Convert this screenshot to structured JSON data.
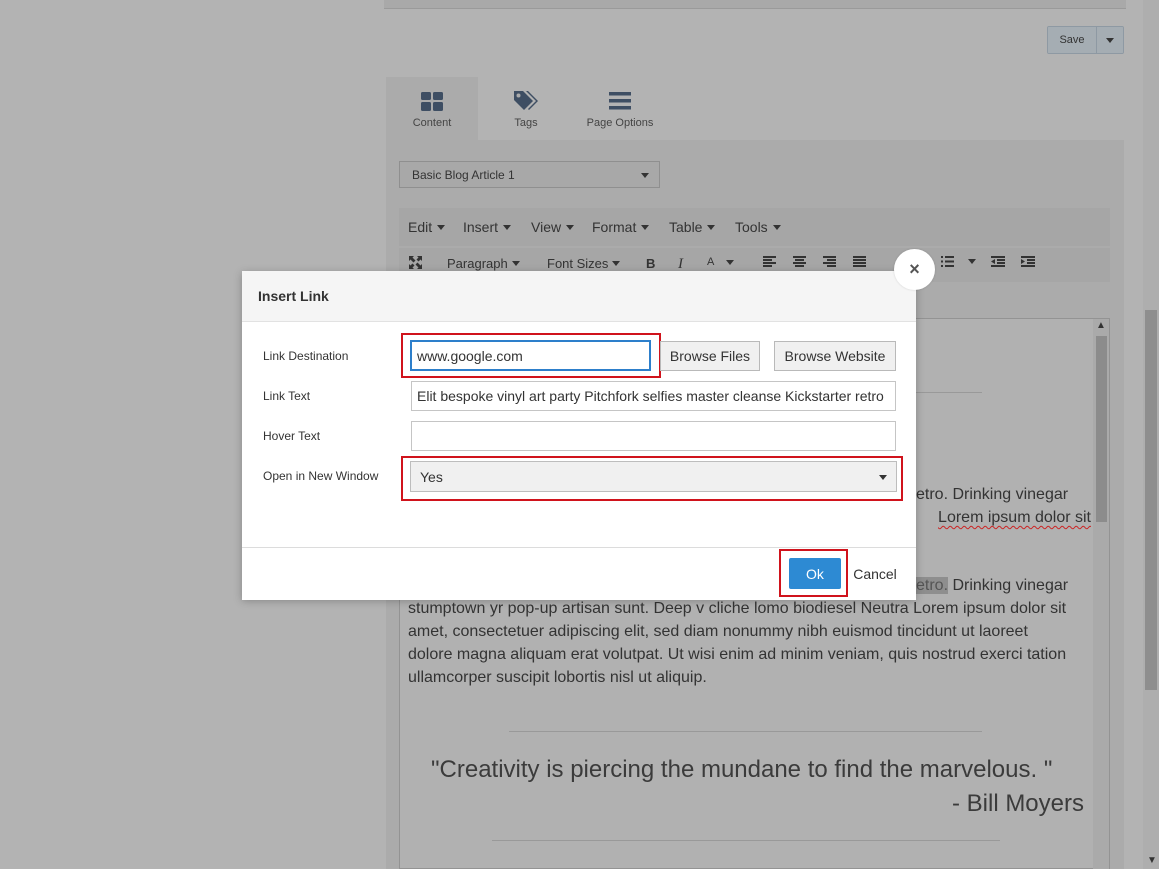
{
  "toolbar_top": {
    "save_label": "Save"
  },
  "tabs": [
    {
      "label": "Content",
      "icon": "grid-icon"
    },
    {
      "label": "Tags",
      "icon": "tags-icon"
    },
    {
      "label": "Page Options",
      "icon": "menu-icon"
    }
  ],
  "template_select": {
    "value": "Basic Blog Article 1"
  },
  "menubar": [
    "Edit",
    "Insert",
    "View",
    "Format",
    "Table",
    "Tools"
  ],
  "format_toolbar": {
    "block_format": "Paragraph",
    "font_sizes": "Font Sizes",
    "bold": "B",
    "italic": "I",
    "font_color": "A"
  },
  "editor": {
    "para1_line1_tail": "etro. Drinking vinegar",
    "para1_line2_tail": "Lorem ipsum dolor sit",
    "para2_line1_highlight": "etro.",
    "para2_line1_tail": " Drinking vinegar",
    "para2_lines": [
      "stumptown yr pop-up artisan sunt. Deep v cliche lomo biodiesel Neutra Lorem ipsum dolor sit",
      "amet, consectetuer adipiscing elit, sed diam nonummy nibh euismod tincidunt ut laoreet",
      "dolore magna aliquam erat volutpat. Ut wisi enim ad minim veniam, quis nostrud exerci tation",
      "ullamcorper suscipit lobortis nisl ut aliquip."
    ],
    "quote": "\"Creativity is piercing the mundane to find the marvelous. \"",
    "quote_author": "- Bill Moyers"
  },
  "dialog": {
    "title": "Insert Link",
    "close_glyph": "×",
    "link_destination_label": "Link Destination",
    "link_destination_value": "www.google.com",
    "browse_files_label": "Browse Files",
    "browse_website_label": "Browse Website",
    "link_text_label": "Link Text",
    "link_text_value": "Elit bespoke vinyl art party Pitchfork selfies master cleanse Kickstarter retro",
    "hover_text_label": "Hover Text",
    "hover_text_value": "",
    "open_new_window_label": "Open in New Window",
    "open_new_window_value": "Yes",
    "ok_label": "Ok",
    "cancel_label": "Cancel"
  },
  "colors": {
    "overlay_bg": "#b3b3b3",
    "primary_button": "#2d8ad3",
    "focus_border": "#2d7fcb",
    "highlight_box": "#d0131c"
  }
}
